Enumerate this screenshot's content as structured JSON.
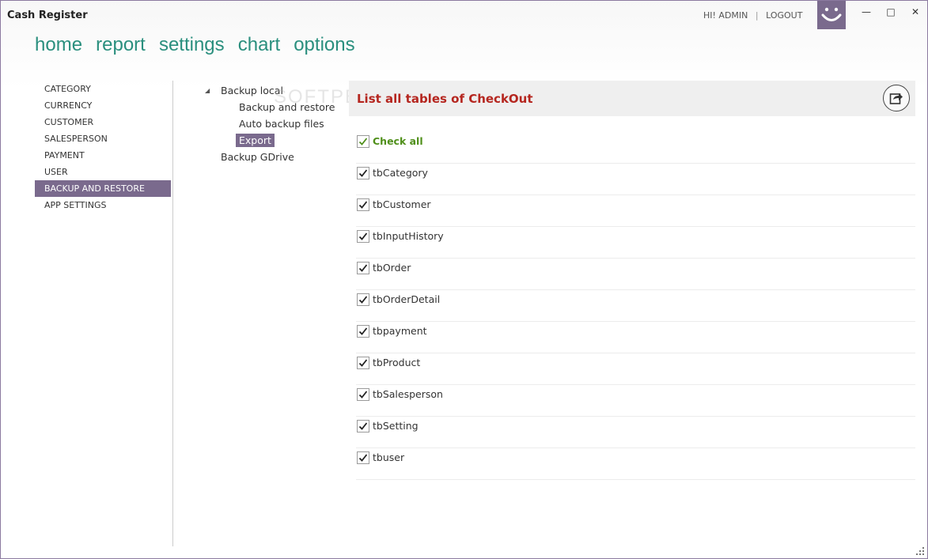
{
  "window": {
    "title": "Cash Register"
  },
  "user": {
    "greeting": "HI! ADMIN",
    "logout": "LOGOUT"
  },
  "window_controls": {
    "minimize": "—",
    "maximize": "□",
    "close": "✕"
  },
  "nav": [
    "home",
    "report",
    "settings",
    "chart",
    "options"
  ],
  "left_menu": {
    "items": [
      "CATEGORY",
      "CURRENCY",
      "CUSTOMER",
      "SALESPERSON",
      "PAYMENT",
      "USER",
      "BACKUP AND RESTORE",
      "APP SETTINGS"
    ],
    "active": "BACKUP AND RESTORE"
  },
  "tree": {
    "root1": "Backup local",
    "children": [
      "Backup and restore",
      "Auto backup files",
      "Export"
    ],
    "selected_child": "Export",
    "root2": "Backup GDrive"
  },
  "watermark": "SOFTPEDIA",
  "panel": {
    "title": "List all tables of CheckOut",
    "export_icon": "export-icon"
  },
  "checklist": {
    "check_all": {
      "label": "Check all",
      "checked": true
    },
    "tables": [
      {
        "label": "tbCategory",
        "checked": true
      },
      {
        "label": "tbCustomer",
        "checked": true
      },
      {
        "label": "tbInputHistory",
        "checked": true
      },
      {
        "label": "tbOrder",
        "checked": true
      },
      {
        "label": "tbOrderDetail",
        "checked": true
      },
      {
        "label": "tbpayment",
        "checked": true
      },
      {
        "label": "tbProduct",
        "checked": true
      },
      {
        "label": "tbSalesperson",
        "checked": true
      },
      {
        "label": "tbSetting",
        "checked": true
      },
      {
        "label": "tbuser",
        "checked": true
      }
    ]
  },
  "colors": {
    "accent": "#7a6a8d",
    "nav_text": "#2a8f7e",
    "panel_title": "#b5261f",
    "check_all": "#4f8f1a"
  }
}
